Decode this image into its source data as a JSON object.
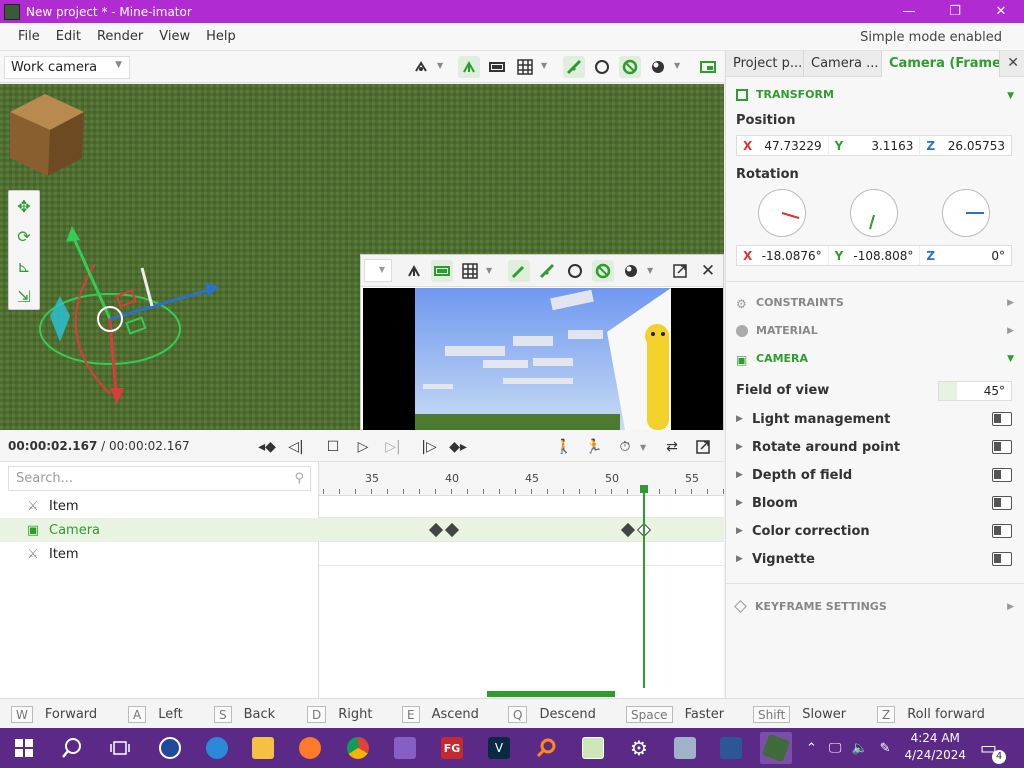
{
  "window": {
    "title": "New project * - Mine-imator",
    "minimize": "—",
    "maximize": "❐",
    "close": "✕"
  },
  "menu": {
    "items": [
      "File",
      "Edit",
      "Render",
      "View",
      "Help"
    ],
    "mode_label": "Simple mode enabled"
  },
  "toolbar": {
    "camera_select": "Work camera"
  },
  "timeline": {
    "current_time": "00:00:02.167",
    "total_time": "/ 00:00:02.167",
    "search_placeholder": "Search...",
    "ruler_labels": [
      "35",
      "40",
      "45",
      "50",
      "55"
    ],
    "tree": [
      {
        "label": "Item",
        "icon": "item-icon",
        "selected": false
      },
      {
        "label": "Camera",
        "icon": "camera-icon",
        "selected": true
      },
      {
        "label": "Item",
        "icon": "item-icon",
        "selected": false
      }
    ]
  },
  "panel": {
    "tabs": [
      "Project p...",
      "Camera ...",
      "Camera (Frame ..."
    ],
    "transform": {
      "header": "TRANSFORM",
      "position_label": "Position",
      "position": {
        "x": "47.73229",
        "y": "3.1163",
        "z": "26.05753"
      },
      "rotation_label": "Rotation",
      "rotation": {
        "x": "-18.0876°",
        "y": "-108.808°",
        "z": "0°"
      }
    },
    "sections": {
      "constraints": "CONSTRAINTS",
      "material": "MATERIAL",
      "camera": "CAMERA",
      "keyframe": "KEYFRAME SETTINGS"
    },
    "fov_label": "Field of view",
    "fov_value": "45°",
    "options": [
      "Light management",
      "Rotate around point",
      "Depth of field",
      "Bloom",
      "Color correction",
      "Vignette"
    ]
  },
  "shortcuts": [
    {
      "key": "W",
      "label": "Forward"
    },
    {
      "key": "A",
      "label": "Left"
    },
    {
      "key": "S",
      "label": "Back"
    },
    {
      "key": "D",
      "label": "Right"
    },
    {
      "key": "E",
      "label": "Ascend"
    },
    {
      "key": "Q",
      "label": "Descend"
    },
    {
      "key": "Space",
      "label": "Faster"
    },
    {
      "key": "Shift",
      "label": "Slower"
    },
    {
      "key": "Z",
      "label": "Roll forward"
    }
  ],
  "taskbar": {
    "time": "4:24 AM",
    "date": "4/24/2024",
    "notification_count": "4",
    "apps": [
      "start-icon",
      "search-icon",
      "task-view-icon",
      "obama-icon",
      "edge-icon",
      "file-explorer-icon",
      "firefox-icon",
      "chrome-icon",
      "visual-studio-icon",
      "fg-icon",
      "vegas-icon",
      "search-app-icon",
      "notepad-icon",
      "settings-icon",
      "photos-icon",
      "word-icon",
      "mine-imator-icon"
    ]
  },
  "colors": {
    "accent": "#2e9d2e",
    "titlebar": "#b12bd2",
    "taskbar": "#5b2a86"
  }
}
